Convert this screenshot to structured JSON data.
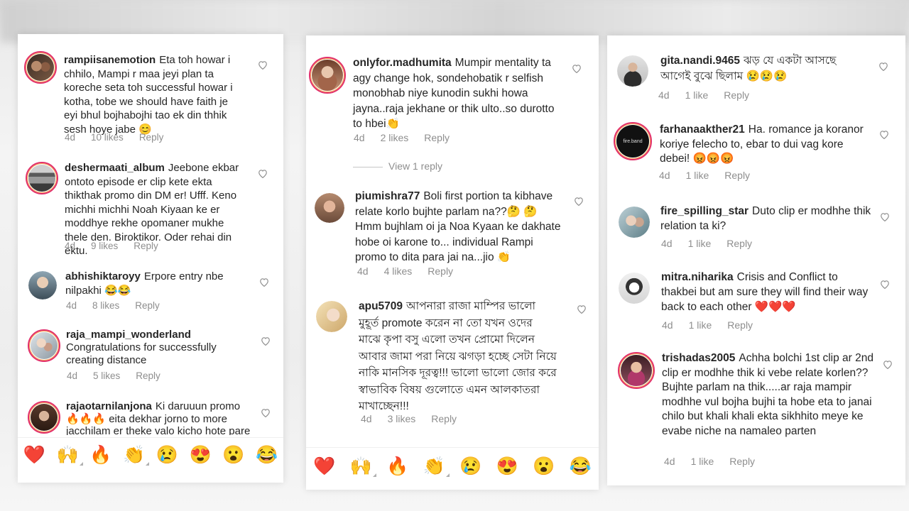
{
  "left": {
    "comments": [
      {
        "username": "rampiisanemotion",
        "text": "Eta toh howar i chhilo, Mampi r maa jeyi plan ta koreche seta toh successful howar i kotha, tobe we should have faith je eyi bhul bojhabojhi tao ek din thhik sesh hoye jabe 😊",
        "time": "4d",
        "likes": "10 likes",
        "reply": "Reply"
      },
      {
        "username": "deshermaati_album",
        "text": "Jeebone ekbar ontoto episode er clip kete ekta thikthak promo din DM er! Ufff. Keno michhi michhi Noah Kiyaan ke er moddhye rekhe opomaner mukhe thele den. Biroktikor. Oder rehai din ektu.",
        "time": "4d",
        "likes": "9 likes",
        "reply": "Reply"
      },
      {
        "username": "abhishiktaroyy",
        "text": "Erpore entry nbe nilpakhi 😂😂",
        "time": "4d",
        "likes": "8 likes",
        "reply": "Reply"
      },
      {
        "username": "raja_mampi_wonderland",
        "text": "Congratulations for successfully creating distance",
        "time": "4d",
        "likes": "5 likes",
        "reply": "Reply"
      },
      {
        "username": "rajaotarnilanjona",
        "text": "Ki daruuun promo 🔥🔥🔥 eita dekhar jorno to more jacchilam er theke valo kicho hote pare",
        "time": "",
        "likes": "",
        "reply": ""
      }
    ],
    "emojis": [
      "❤️",
      "🙌",
      "🔥",
      "👏",
      "😢",
      "😍",
      "😮",
      "😂"
    ]
  },
  "middle": {
    "comments": [
      {
        "username": "onlyfor.madhumita",
        "text": "Mumpir mentality ta agy change hok, sondehobatik r selfish monobhab niye kunodin sukhi howa jayna..raja jekhane or thik ulto..so durotto to hbei👏",
        "time": "4d",
        "likes": "2 likes",
        "reply": "Reply"
      },
      {
        "username": "piumishra77",
        "text": "Boli first portion ta kibhave relate korlo bujhte parlam na??🤔 🤔 Hmm bujhlam oi ja Noa Kyaan ke dakhate hobe oi karone to... individual Rampi promo to dita para jai na...jio 👏",
        "time": "4d",
        "likes": "4 likes",
        "reply": "Reply"
      },
      {
        "username": "apu5709",
        "text": "আপনারা রাজা মাম্পির ভালো মুহূর্ত promote করেন না তো যখন ওদের মাঝে কৃপা বসু এলো তখন প্রোমো দিলেন আবার জামা পরা নিয়ে ঝগড়া হচ্ছে সেটা নিয়ে নাকি মানসিক দূরত্ব!!! ভালো ভালো জোর করে স্বাভাবিক বিষয় গুলোতে এমন আলকাতরা মাখাচ্ছেন!!!",
        "time": "4d",
        "likes": "3 likes",
        "reply": "Reply"
      }
    ],
    "view_replies": "View 1 reply",
    "emojis": [
      "❤️",
      "🙌",
      "🔥",
      "👏",
      "😢",
      "😍",
      "😮",
      "😂"
    ]
  },
  "right": {
    "comments": [
      {
        "username": "gita.nandi.9465",
        "text": "ঝড় যে একটা আসছে আগেই বুঝে ছিলাম 😢😢😢",
        "time": "4d",
        "likes": "1 like",
        "reply": "Reply"
      },
      {
        "username": "farhanaakther21",
        "text": "Ha.  romance ja koranor koriye felecho to, ebar to dui vag kore debei! 😡😡😡",
        "time": "4d",
        "likes": "1 like",
        "reply": "Reply"
      },
      {
        "username": "fire_spilling_star",
        "text": "Duto clip er modhhe thik relation ta ki?",
        "time": "4d",
        "likes": "1 like",
        "reply": "Reply"
      },
      {
        "username": "mitra.niharika",
        "text": "Crisis and Conflict to thakbei but am sure they will find their way back to each other ❤️❤️❤️",
        "time": "4d",
        "likes": "1 like",
        "reply": "Reply"
      },
      {
        "username": "trishadas2005",
        "text": "Achha bolchi 1st clip ar 2nd clip er modhhe thik ki vebe relate korlen?? Bujhte parlam na thik.....ar raja mampir modhhe vul bojha bujhi ta hobe eta to janai chilo but khali khali ekta sikhhito meye ke evabe niche na namaleo parten",
        "time": "4d",
        "likes": "1 like",
        "reply": "Reply"
      }
    ],
    "avatar_badge": "fire.band"
  }
}
